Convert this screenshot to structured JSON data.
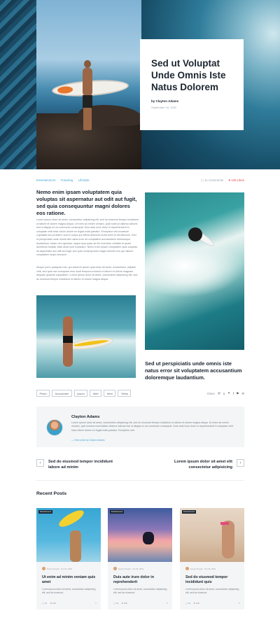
{
  "hero": {
    "title": "Sed ut Voluptat Unde Omnis Iste Natus Dolorem",
    "author": "by Clayton Adams",
    "date": "September 16, 2022"
  },
  "meta": {
    "categories": [
      "Entertainment",
      "Traveling",
      "Lifestyle"
    ],
    "comments": "11 Comments",
    "likes": "125 Likes",
    "comment_icon": "comment-icon",
    "heart_icon": "heart-icon"
  },
  "article": {
    "lead": "Nemo enim ipsam voluptatem quia voluptas sit aspernatur aut odit aut fugit, sed quia consequuntur magni dolores eos ratione.",
    "para1": "Lorem ipsum dolor sit amet, consectetur adipiscing elit, sed do eiusmod tempor incididunt ut labore et dolore magna aliqua. Ut enim ad minim veniam, quis nostrud ullamco laboris nisi ut aliquip ex ea commodo consequat. Duis aute irure dolor in reprehenderit in voluptate velit esse cillum dolore eu fugiat nulla pariatur. Excepteur sint occaecat cupidatat non proident, sunt in culpa qui officia deserunt mollit anim id est laborum. Sed ut perspiciatis unde omnis iste natus error sit voluptatem accusantium doloremque laudantium, totam rem aperiam, eaque ipsa quae ab illo inventore veritatis et quasi architecto beatae vitae dicta sunt explicabo. Nemo enim ipsam voluptatem quia voluptas sit aspernatur aut odit aut fugit, sed quia consequuntur magni dolores eos qui ratione voluptatem sequi nesciunt.",
    "para2": "Neque porro quisquam est, qui dolorem ipsum quia dolor sit amet, consectetur, adipisci velit, sed quia non numquam eius modi tempora incidunt ut labore et dolore magnam aliquam quaerat voluptatem. Lorem ipsum dolor sit amet, consectetur adipiscing elit, sed do eiusmod tempor incididunt ut labore et dolore magna aliqua.",
    "quote": "Sed ut perspiciatis unde omnis iste natus error sit voluptatem accusantium doloremque laudantium."
  },
  "tags": [
    "Photo",
    "Accusmaer",
    "Ipsum",
    "Web",
    "Nem",
    "Tellus"
  ],
  "share": {
    "label": "Share",
    "icons": [
      "instagram-icon",
      "vimeo-icon",
      "twitter-icon",
      "facebook-icon",
      "youtube-icon",
      "pinterest-icon"
    ]
  },
  "author_box": {
    "name": "Clayton Adams",
    "bio": "Lorem ipsum dolor sit amet, consectetur adipiscing elit, sed do eiusmod tempor incididunt ut labore et dolore magna aliqua. Ut enim ad minim veniam, quis nostrud exercitation ullamco laboris nisi ut aliquip ex ea commodo consequat. Duis aute irure dolor in reprehenderit in voluptate velit esse cillum dolore eu fugiat nulla pariatur. Excepteur sint.",
    "link": "— View posts by Clayton Adams"
  },
  "post_nav": {
    "prev_arrow": "‹",
    "next_arrow": "›",
    "prev_title": "Sed do eiusmod tempor incididunt labore ad minim",
    "next_title": "Lorem ipsum dolor sit amet elit consectetur adipisicing"
  },
  "recent": {
    "heading": "Recent Posts",
    "cards": [
      {
        "badge": "Entertainment",
        "author": "Evelyn Snyder",
        "date": "Oct 09, 2022",
        "title": "Ut enim ad minim veniam quis amet",
        "excerpt": "Lorem ipsum dolor sit amet, consectetur adipiscing elit, sed do eiusmod.",
        "comments": "24",
        "likes": "148"
      },
      {
        "badge": "Entertainment",
        "author": "Evelyn Snyder",
        "date": "Oct 09, 2022",
        "title": "Duis aute irure dolor in reprehenderit",
        "excerpt": "Lorem ipsum dolor sit amet, consectetur adipiscing elit, sed do eiusmod.",
        "comments": "24",
        "likes": "148"
      },
      {
        "badge": "Entertainment",
        "author": "Evelyn Snyder",
        "date": "Oct 09, 2022",
        "title": "Sed do eiusmod tempor incididunt quis",
        "excerpt": "Lorem ipsum dolor sit amet, consectetur adipiscing elit, sed do eiusmod.",
        "comments": "24",
        "likes": "148"
      }
    ]
  },
  "colors": {
    "accent": "#4ba7d8",
    "like": "#e0474c",
    "heading": "#1c2530"
  }
}
